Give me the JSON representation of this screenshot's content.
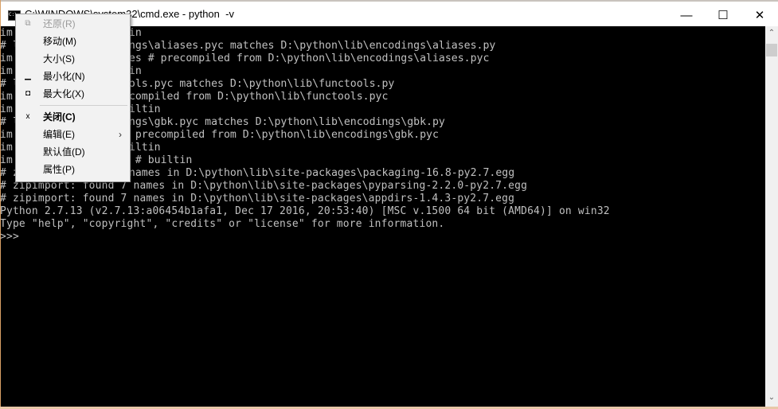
{
  "window": {
    "title": "C:\\WINDOWS\\system32\\cmd.exe - python  -v",
    "icon": "cmd-icon",
    "controls": {
      "minimize": "—",
      "maximize": "☐",
      "close": "✕"
    }
  },
  "console": {
    "lines": [
      {
        "left": "im",
        "right": "ltin"
      },
      {
        "left": "# l",
        "right": "dings\\aliases.pyc matches D:\\python\\lib\\encodings\\aliases.py"
      },
      {
        "left": "im",
        "right": "ases # precompiled from D:\\python\\lib\\encodings\\aliases.pyc"
      },
      {
        "left": "im",
        "right": "ltin"
      },
      {
        "left": "# l",
        "right": "tools.pyc matches D:\\python\\lib\\functools.py"
      },
      {
        "left": "im",
        "right": "recompiled from D:\\python\\lib\\functools.pyc"
      },
      {
        "left": "im",
        "right": "builtin"
      },
      {
        "left": "# l",
        "right": "dings\\gbk.pyc matches D:\\python\\lib\\encodings\\gbk.py"
      },
      {
        "left": "im",
        "right": " # precompiled from D:\\python\\lib\\encodings\\gbk.pyc"
      },
      {
        "left": "im",
        "right": "builtin"
      },
      {
        "left": "im",
        "right": "ec # builtin"
      },
      {
        "left": "# z",
        "right": "4 names in D:\\python\\lib\\site-packages\\packaging-16.8-py2.7.egg"
      },
      {
        "full": "# zipimport: found 7 names in D:\\python\\lib\\site-packages\\pyparsing-2.2.0-py2.7.egg"
      },
      {
        "full": "# zipimport: found 7 names in D:\\python\\lib\\site-packages\\appdirs-1.4.3-py2.7.egg"
      },
      {
        "full": "Python 2.7.13 (v2.7.13:a06454b1afa1, Dec 17 2016, 20:53:40) [MSC v.1500 64 bit (AMD64)] on win32"
      },
      {
        "full": "Type \"help\", \"copyright\", \"credits\" or \"license\" for more information."
      },
      {
        "full": ">>>"
      }
    ]
  },
  "system_menu": {
    "items": [
      {
        "label": "还原(R)",
        "icon": "restore-icon",
        "glyph": "⧉",
        "disabled": true
      },
      {
        "label": "移动(M)",
        "icon": "",
        "glyph": ""
      },
      {
        "label": "大小(S)",
        "icon": "",
        "glyph": ""
      },
      {
        "label": "最小化(N)",
        "icon": "minimize-icon",
        "glyph": "▁"
      },
      {
        "label": "最大化(X)",
        "icon": "maximize-icon",
        "glyph": "◘"
      },
      {
        "label": "关闭(C)",
        "icon": "close-icon",
        "glyph": "x",
        "bold": true
      },
      {
        "label": "编辑(E)",
        "icon": "",
        "glyph": "",
        "submenu": "›"
      },
      {
        "label": "默认值(D)",
        "icon": "",
        "glyph": ""
      },
      {
        "label": "属性(P)",
        "icon": "",
        "glyph": ""
      }
    ]
  },
  "scrollbar": {
    "up": "⌃",
    "down": "⌄"
  }
}
